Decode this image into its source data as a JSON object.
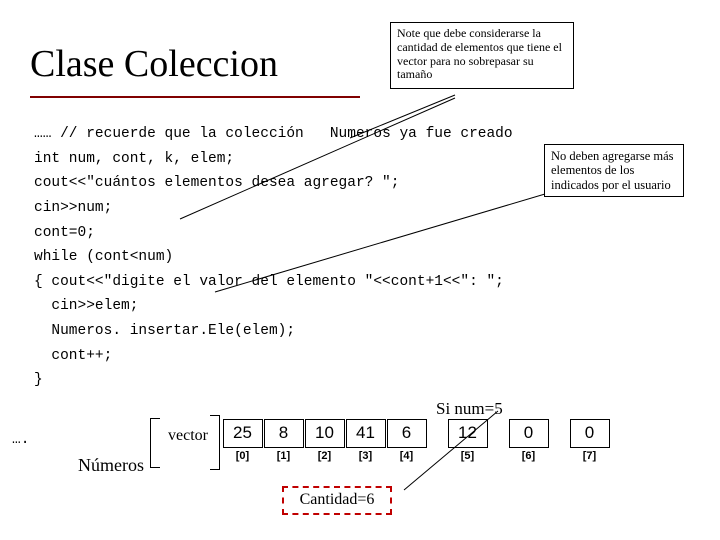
{
  "title": "Clase Coleccion",
  "note_top": "Note que debe considerarse la cantidad de elementos que tiene el vector para no sobrepasar su tamaño",
  "note_right": "No deben agregarse más elementos de los indicados por el usuario",
  "code_lines": {
    "l1a": "…… // recuerde que la colección",
    "l1b": "   Numeros ya fue creado",
    "l2": "int num, cont, k, elem;",
    "l3": "cout<<\"cuántos elementos desea agregar? \";",
    "l4": "cin>>num;",
    "l5": "cont=0;",
    "l6": "while (cont<num)",
    "l7": "{ cout<<\"digite el valor del elemento \"<<cont+1<<\": \";",
    "l8": "  cin>>elem;",
    "l9": "  Numeros. insertar.Ele(elem);",
    "l10": "  cont++;",
    "l11": "}"
  },
  "ellipsis": "….",
  "numeros_label": "Números",
  "vector_label": "vector",
  "sinum_label": "Si num=5",
  "cantidad_label": "Cantidad=6",
  "chart_data": {
    "type": "table",
    "title": "vector Números",
    "columns": [
      "[0]",
      "[1]",
      "[2]",
      "[3]",
      "[4]",
      "[5]",
      "[6]",
      "[7]"
    ],
    "values": [
      25,
      8,
      10,
      41,
      6,
      12,
      0,
      0
    ],
    "highlight_count": 5,
    "cantidad": 6,
    "num": 5
  }
}
